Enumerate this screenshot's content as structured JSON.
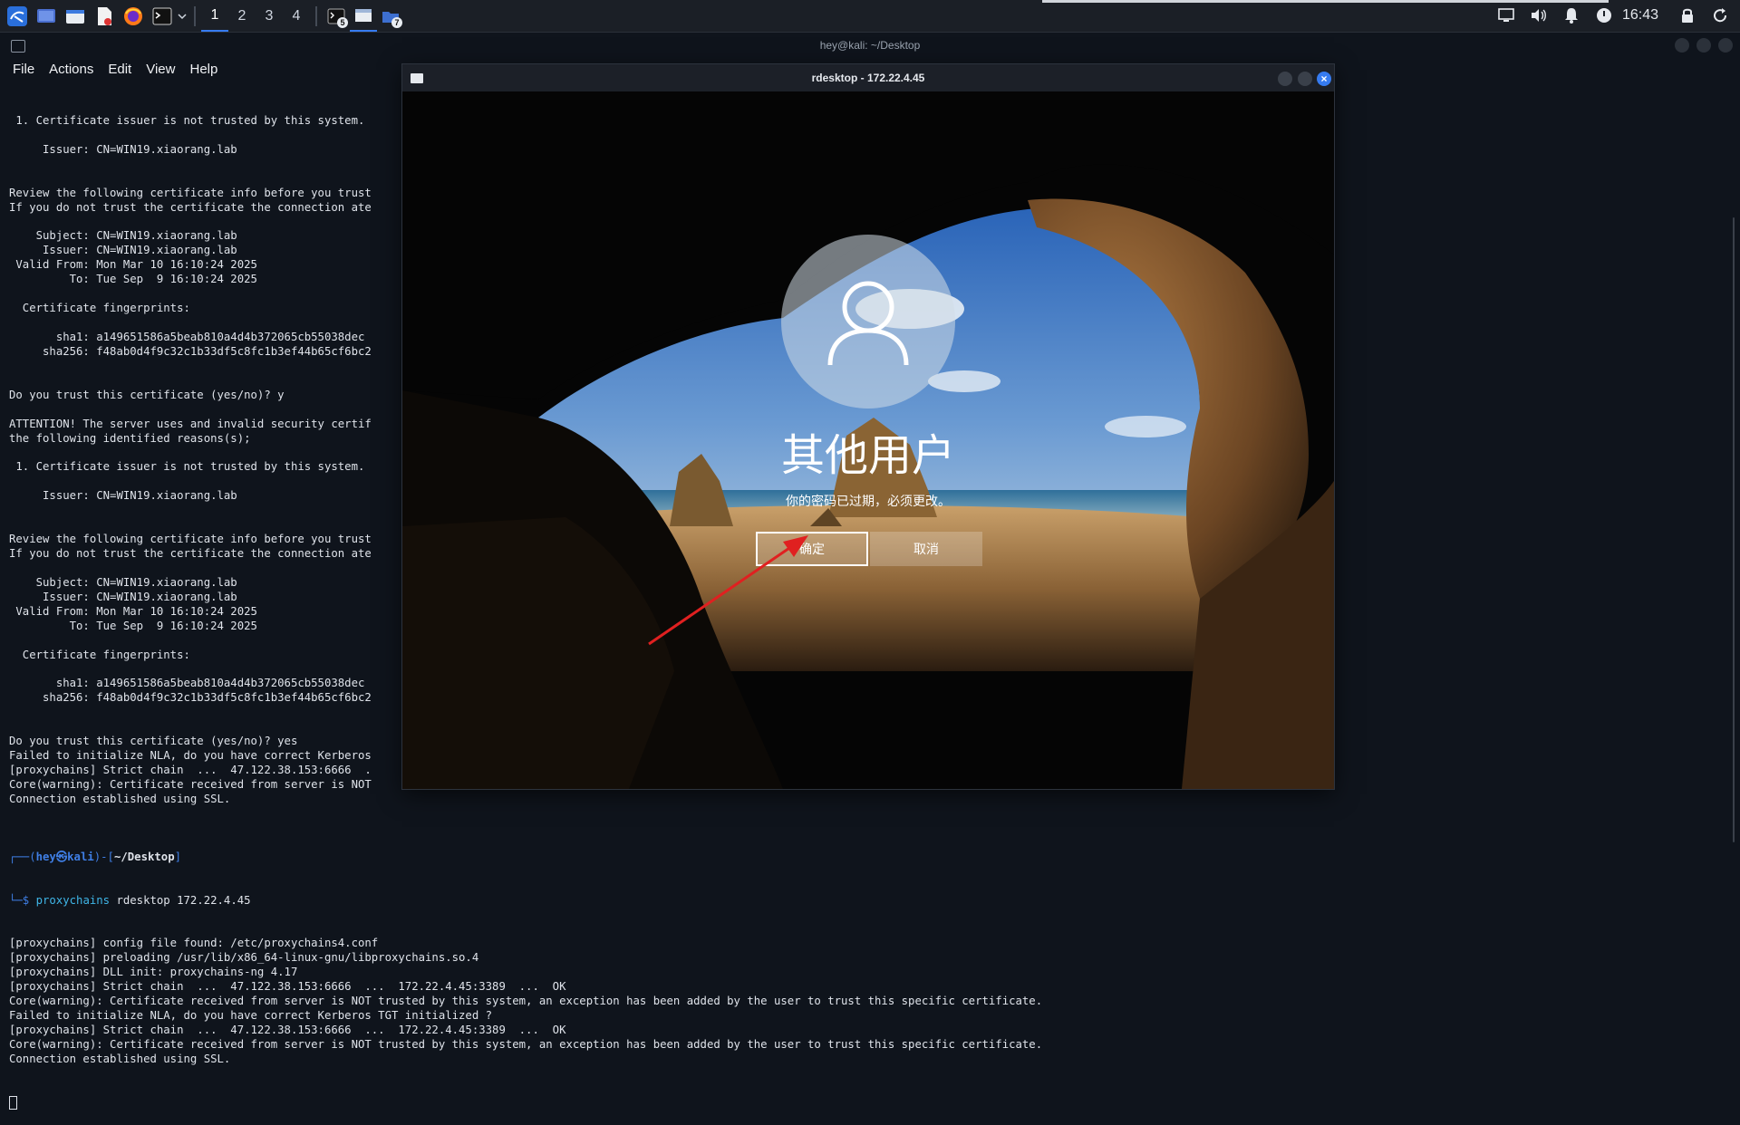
{
  "taskbar": {
    "app_icons": [
      "kali-menu-icon",
      "desktop-icon",
      "file-manager-icon",
      "text-editor-icon",
      "firefox-icon",
      "terminal-icon",
      "dropdown-chevron-icon"
    ],
    "workspaces": [
      "1",
      "2",
      "3",
      "4"
    ],
    "active_workspace": "1",
    "tasks": [
      {
        "icon": "terminal-window-icon",
        "badge": "5"
      },
      {
        "icon": "rdesktop-window-icon",
        "badge": ""
      },
      {
        "icon": "folder-window-icon",
        "badge": "7"
      }
    ],
    "tray_icons": [
      "display-icon",
      "volume-icon",
      "notification-bell-icon",
      "power-indicator-icon",
      "lock-icon",
      "refresh-icon"
    ],
    "clock": "16:43",
    "accent_color": "#367bf0"
  },
  "terminal": {
    "title": "hey@kali: ~/Desktop",
    "menu": [
      "File",
      "Actions",
      "Edit",
      "View",
      "Help"
    ],
    "lines": [
      " 1. Certificate issuer is not trusted by this system.",
      "",
      "     Issuer: CN=WIN19.xiaorang.lab",
      "",
      "",
      "Review the following certificate info before you trust",
      "If you do not trust the certificate the connection ate",
      "",
      "    Subject: CN=WIN19.xiaorang.lab",
      "     Issuer: CN=WIN19.xiaorang.lab",
      " Valid From: Mon Mar 10 16:10:24 2025",
      "         To: Tue Sep  9 16:10:24 2025",
      "",
      "  Certificate fingerprints:",
      "",
      "       sha1: a149651586a5beab810a4d4b372065cb55038dec",
      "     sha256: f48ab0d4f9c32c1b33df5c8fc1b3ef44b65cf6bc2",
      "",
      "",
      "Do you trust this certificate (yes/no)? y",
      "",
      "ATTENTION! The server uses and invalid security certif",
      "the following identified reasons(s);",
      "",
      " 1. Certificate issuer is not trusted by this system.",
      "",
      "     Issuer: CN=WIN19.xiaorang.lab",
      "",
      "",
      "Review the following certificate info before you trust",
      "If you do not trust the certificate the connection ate",
      "",
      "    Subject: CN=WIN19.xiaorang.lab",
      "     Issuer: CN=WIN19.xiaorang.lab",
      " Valid From: Mon Mar 10 16:10:24 2025",
      "         To: Tue Sep  9 16:10:24 2025",
      "",
      "  Certificate fingerprints:",
      "",
      "       sha1: a149651586a5beab810a4d4b372065cb55038dec",
      "     sha256: f48ab0d4f9c32c1b33df5c8fc1b3ef44b65cf6bc2",
      "",
      "",
      "Do you trust this certificate (yes/no)? yes",
      "Failed to initialize NLA, do you have correct Kerberos",
      "[proxychains] Strict chain  ...  47.122.38.153:6666  .",
      "Core(warning): Certificate received from server is NOT",
      "Connection established using SSL.",
      ""
    ],
    "prompt": {
      "corner_top": "┌──(",
      "user_host": "hey㉿kali",
      "mid": ")-[",
      "cwd": "~/Desktop",
      "end": "]",
      "corner_bottom": "└─$ ",
      "command": "proxychains",
      "args": " rdesktop 172.22.4.45"
    },
    "after_lines": [
      "[proxychains] config file found: /etc/proxychains4.conf",
      "[proxychains] preloading /usr/lib/x86_64-linux-gnu/libproxychains.so.4",
      "[proxychains] DLL init: proxychains-ng 4.17",
      "[proxychains] Strict chain  ...  47.122.38.153:6666  ...  172.22.4.45:3389  ...  OK",
      "Core(warning): Certificate received from server is NOT trusted by this system, an exception has been added by the user to trust this specific certificate.",
      "Failed to initialize NLA, do you have correct Kerberos TGT initialized ?",
      "[proxychains] Strict chain  ...  47.122.38.153:6666  ...  172.22.4.45:3389  ...  OK",
      "Core(warning): Certificate received from server is NOT trusted by this system, an exception has been added by the user to trust this specific certificate.",
      "Connection established using SSL."
    ]
  },
  "rdesktop": {
    "title": "rdesktop - 172.22.4.45",
    "login": {
      "user_name": "其他用户",
      "message": "你的密码已过期，必须更改。",
      "ok_label": "确定",
      "cancel_label": "取消"
    },
    "annotation_arrow_color": "#e02020"
  }
}
